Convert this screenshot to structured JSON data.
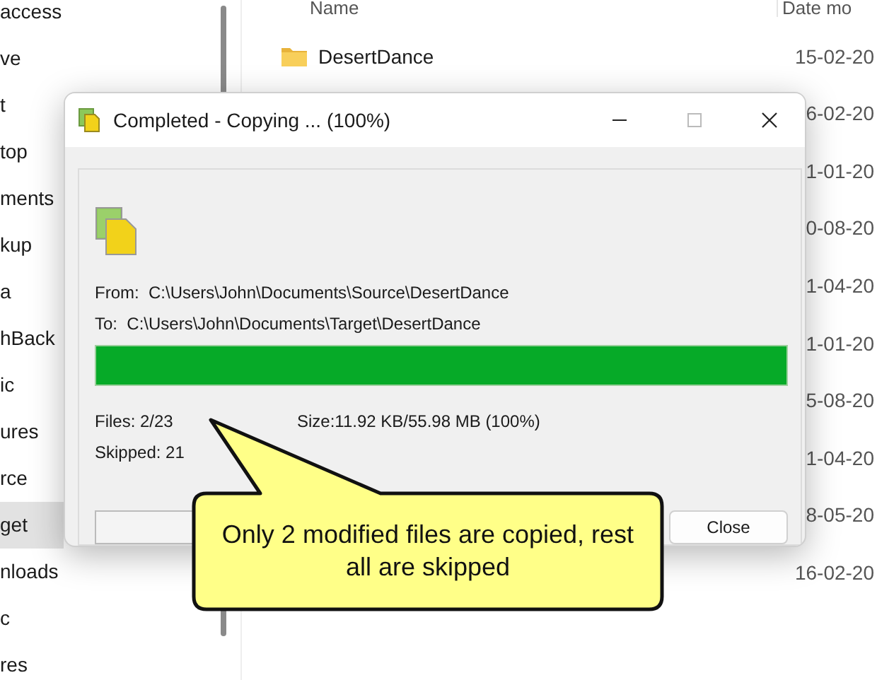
{
  "explorer": {
    "sidebar": [
      {
        "label": "access",
        "selected": false
      },
      {
        "label": "ve",
        "selected": false
      },
      {
        "label": "t",
        "selected": false
      },
      {
        "label": "top",
        "selected": false
      },
      {
        "label": "ments",
        "selected": false
      },
      {
        "label": "kup",
        "selected": false
      },
      {
        "label": "a",
        "selected": false
      },
      {
        "label": "hBack",
        "selected": false
      },
      {
        "label": "ic",
        "selected": false
      },
      {
        "label": "ures",
        "selected": false
      },
      {
        "label": "rce",
        "selected": false
      },
      {
        "label": "get",
        "selected": true
      },
      {
        "label": "nloads",
        "selected": false
      },
      {
        "label": "c",
        "selected": false
      },
      {
        "label": "res",
        "selected": false
      }
    ],
    "columns": [
      "Name",
      "Date mo"
    ],
    "rows": [
      {
        "name": "DesertDance",
        "date": "15-02-20"
      },
      {
        "date": "6-02-20"
      },
      {
        "date": "1-01-20"
      },
      {
        "date": "0-08-20"
      },
      {
        "date": "1-04-20"
      },
      {
        "date": "1-01-20"
      },
      {
        "date": "5-08-20"
      },
      {
        "date": "1-04-20"
      },
      {
        "date": "8-05-20"
      },
      {
        "date": "16-02-20"
      }
    ]
  },
  "dialog": {
    "title": "Completed - Copying ... (100%)",
    "from_label": "From:",
    "from": "C:\\Users\\John\\Documents\\Source\\DesertDance",
    "to_label": "To:",
    "to": "C:\\Users\\John\\Documents\\Target\\DesertDance",
    "progress": {
      "level": 1
    },
    "files": "Files: 2/23",
    "size": "Size:11.92 KB/55.98 MB (100%)",
    "skipped": "Skipped: 21",
    "buttons": [
      "Close"
    ]
  },
  "callout": {
    "text": "Only 2 modified files are copied, rest all are skipped"
  }
}
